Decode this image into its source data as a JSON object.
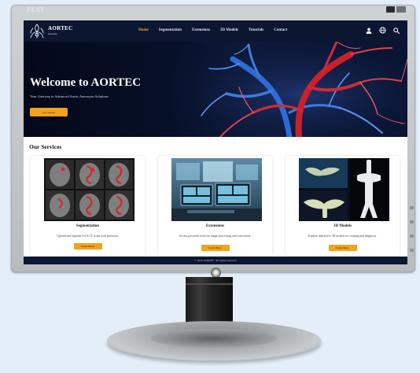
{
  "monitor": {
    "brand": "FLAT"
  },
  "site": {
    "logo_title": "AORTEC",
    "logo_subtitle": "Medicals",
    "nav": [
      {
        "label": "Home",
        "active": true
      },
      {
        "label": "Segmentation",
        "active": false
      },
      {
        "label": "Extensions",
        "active": false
      },
      {
        "label": "3D Models",
        "active": false
      },
      {
        "label": "Tutorials",
        "active": false
      },
      {
        "label": "Contact",
        "active": false
      }
    ],
    "nav_icons": [
      "user-icon",
      "globe-icon",
      "search-icon"
    ],
    "hero": {
      "title": "Welcome to AORTEC",
      "subtitle": "Your Gateway to Advanced Aortic Aneurysm Solutions",
      "cta": "Get Started"
    },
    "services": {
      "heading": "Our Services",
      "cards": [
        {
          "title": "Segmentation",
          "description": "Upload and segment AAA CT scans with precision.",
          "button": "Learn More"
        },
        {
          "title": "Extensions",
          "description": "Access powerful tools for image processing and conversion.",
          "button": "Learn More"
        },
        {
          "title": "3D Models",
          "description": "Explore interactive 3D models for training and diagnosis.",
          "button": "Learn More"
        }
      ]
    },
    "footer": "© 2024 AORTEC. All rights reserved."
  },
  "colors": {
    "navy": "#0b1630",
    "accent": "#f4a21c",
    "vessel_red": "#c8202c",
    "vessel_blue": "#2f6bd6"
  }
}
